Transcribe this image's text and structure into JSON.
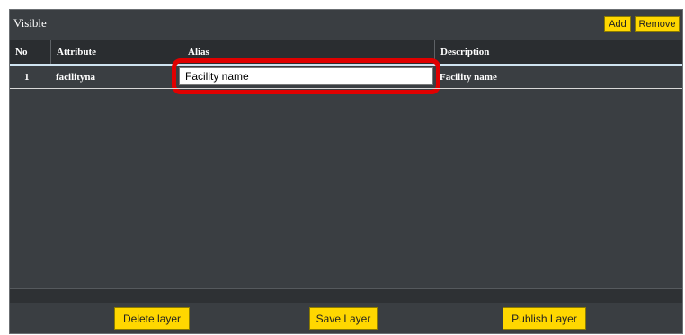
{
  "panel": {
    "title": "Visible",
    "add_label": "Add",
    "remove_label": "Remove"
  },
  "table": {
    "headers": [
      "No",
      "Attribute",
      "Alias",
      "Description"
    ],
    "rows": [
      {
        "no": "1",
        "attribute": "facilityna",
        "alias": "Facility name",
        "description": "Facility name"
      }
    ]
  },
  "footer": {
    "delete_label": "Delete layer",
    "save_label": "Save Layer",
    "publish_label": "Publish Layer"
  },
  "colors": {
    "panel_bg": "#3a3e42",
    "button_yellow": "#ffd700",
    "highlight_red": "#e00000"
  }
}
